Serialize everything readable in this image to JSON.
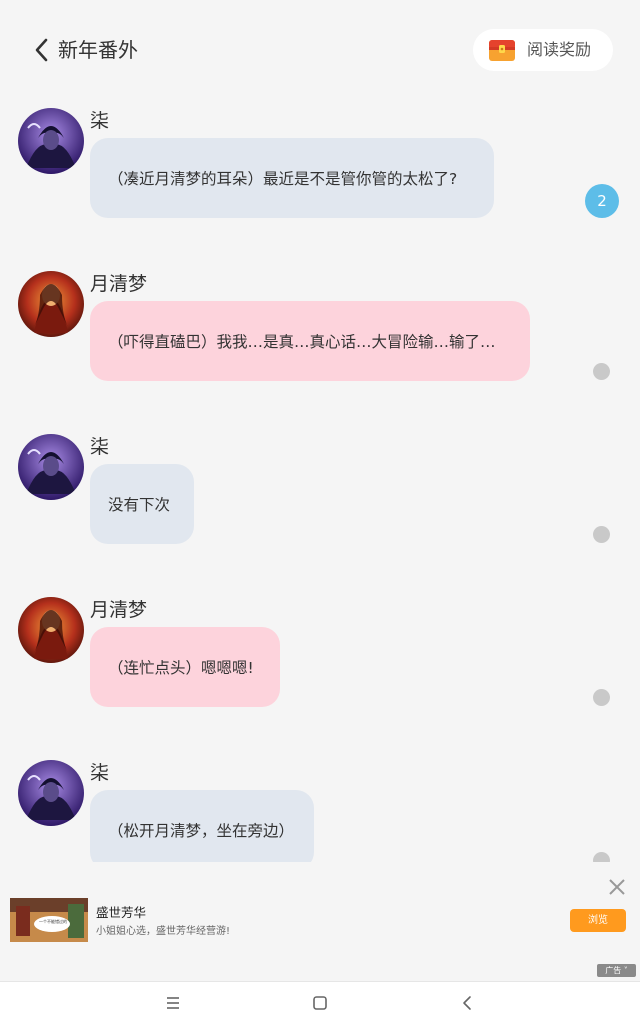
{
  "header": {
    "title": "新年番外",
    "reward_label": "阅读奖励"
  },
  "messages": [
    {
      "speaker": "柒",
      "text": "（凑近月清梦的耳朵）最近是不是管你管的太松了?",
      "style": "blue",
      "comment_count": "2"
    },
    {
      "speaker": "月清梦",
      "text": "（吓得直磕巴）我我…是真…真心话…大冒险输…输了…",
      "style": "pink",
      "comment_count": ""
    },
    {
      "speaker": "柒",
      "text": "没有下次",
      "style": "blue",
      "comment_count": ""
    },
    {
      "speaker": "月清梦",
      "text": "（连忙点头）嗯嗯嗯!",
      "style": "pink",
      "comment_count": ""
    },
    {
      "speaker": "柒",
      "text": "（松开月清梦，坐在旁边）",
      "style": "blue",
      "comment_count": ""
    }
  ],
  "ad": {
    "title": "盛世芳华",
    "description": "小姐姐心选，盛世芳华经营游!",
    "button_label": "浏览",
    "badge": "广告",
    "image_caption": "一个不能错过的"
  },
  "colors": {
    "bubble_blue": "#e1e7ef",
    "bubble_pink": "#fdd3dc",
    "badge_blue": "#5dbde8",
    "ad_button": "#ff9a1e"
  },
  "icons": {
    "back": "chevron-left-icon",
    "reward": "treasure-chest-icon",
    "ad_close": "close-icon",
    "nav_menu": "menu-icon",
    "nav_home": "square-home-icon",
    "nav_back": "chevron-left-icon"
  }
}
